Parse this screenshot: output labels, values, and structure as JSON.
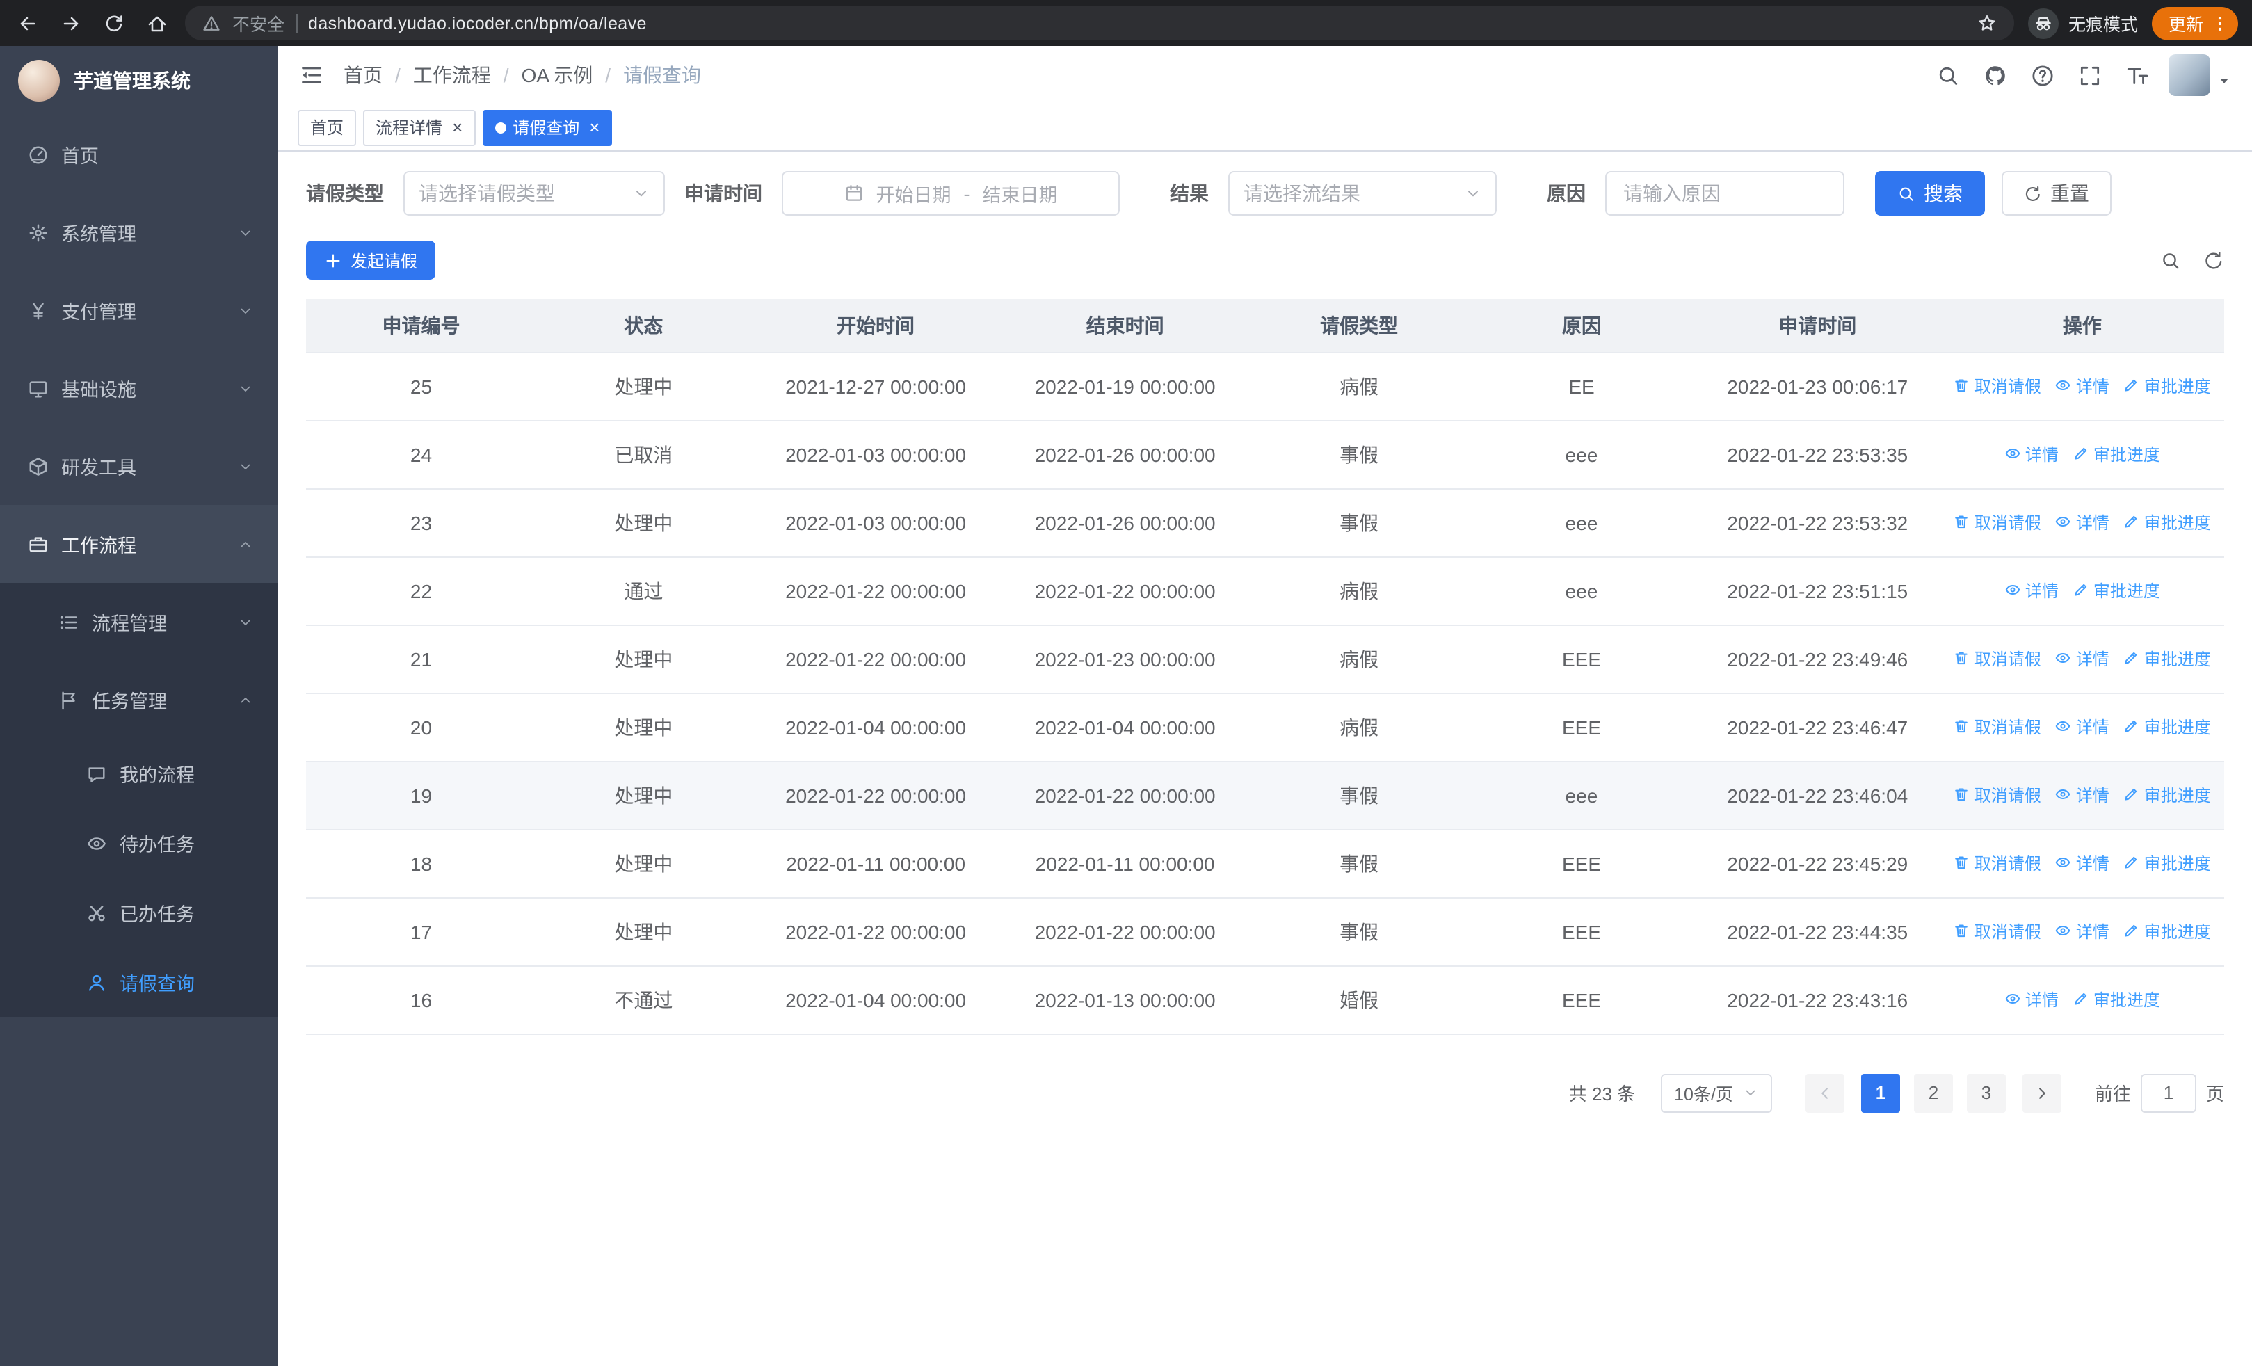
{
  "browser": {
    "nav_icons": [
      "back-icon",
      "forward-icon",
      "reload-icon",
      "home-icon"
    ],
    "security_label": "不安全",
    "url": "dashboard.yudao.iocoder.cn/bpm/oa/leave",
    "incognito_label": "无痕模式",
    "update_label": "更新"
  },
  "sidebar": {
    "title": "芋道管理系统",
    "menu": [
      {
        "label": "首页",
        "icon": "dashboard",
        "level": 1
      },
      {
        "label": "系统管理",
        "icon": "gear",
        "level": 1,
        "arrow": "down"
      },
      {
        "label": "支付管理",
        "icon": "yen",
        "level": 1,
        "arrow": "down"
      },
      {
        "label": "基础设施",
        "icon": "monitor",
        "level": 1,
        "arrow": "down"
      },
      {
        "label": "研发工具",
        "icon": "box",
        "level": 1,
        "arrow": "down"
      },
      {
        "label": "工作流程",
        "icon": "suitcase",
        "level": 1,
        "arrow": "up",
        "open": true
      },
      {
        "label": "流程管理",
        "icon": "list",
        "level": 2,
        "arrow": "down"
      },
      {
        "label": "任务管理",
        "icon": "flag",
        "level": 2,
        "arrow": "up",
        "open": true
      },
      {
        "label": "我的流程",
        "icon": "chat",
        "level": 3
      },
      {
        "label": "待办任务",
        "icon": "eye",
        "level": 3
      },
      {
        "label": "已办任务",
        "icon": "scissors",
        "level": 3
      },
      {
        "label": "请假查询",
        "icon": "user",
        "level": 3,
        "active": true
      }
    ]
  },
  "header": {
    "breadcrumb": [
      "首页",
      "工作流程",
      "OA 示例",
      "请假查询"
    ],
    "action_icons": [
      "search-icon",
      "github-icon",
      "question-icon",
      "fullscreen-icon",
      "font-size-icon"
    ]
  },
  "tabs": [
    {
      "label": "首页",
      "closable": false,
      "active": false
    },
    {
      "label": "流程详情",
      "closable": true,
      "active": false
    },
    {
      "label": "请假查询",
      "closable": true,
      "active": true
    }
  ],
  "filters": {
    "leave_type": {
      "label": "请假类型",
      "placeholder": "请选择请假类型"
    },
    "apply_time": {
      "label": "申请时间",
      "start_placeholder": "开始日期",
      "separator": "-",
      "end_placeholder": "结束日期"
    },
    "result": {
      "label": "结果",
      "placeholder": "请选择流结果"
    },
    "reason": {
      "label": "原因",
      "placeholder": "请输入原因"
    },
    "search_label": "搜索",
    "reset_label": "重置"
  },
  "toolbar": {
    "create_label": "发起请假",
    "right_icons": [
      "search-icon",
      "refresh-icon"
    ]
  },
  "table": {
    "columns": [
      "申请编号",
      "状态",
      "开始时间",
      "结束时间",
      "请假类型",
      "原因",
      "申请时间",
      "操作"
    ],
    "rows": [
      {
        "id": "25",
        "status": "处理中",
        "start": "2021-12-27 00:00:00",
        "end": "2022-01-19 00:00:00",
        "type": "病假",
        "reason": "EE",
        "applied": "2022-01-23 00:06:17",
        "highlighted": false,
        "actions": [
          {
            "icon": "trash-icon",
            "label": "取消请假"
          },
          {
            "icon": "eye-icon",
            "label": "详情"
          },
          {
            "icon": "edit-icon",
            "label": "审批进度"
          }
        ]
      },
      {
        "id": "24",
        "status": "已取消",
        "start": "2022-01-03 00:00:00",
        "end": "2022-01-26 00:00:00",
        "type": "事假",
        "reason": "eee",
        "applied": "2022-01-22 23:53:35",
        "highlighted": false,
        "actions": [
          {
            "icon": "eye-icon",
            "label": "详情"
          },
          {
            "icon": "edit-icon",
            "label": "审批进度"
          }
        ]
      },
      {
        "id": "23",
        "status": "处理中",
        "start": "2022-01-03 00:00:00",
        "end": "2022-01-26 00:00:00",
        "type": "事假",
        "reason": "eee",
        "applied": "2022-01-22 23:53:32",
        "highlighted": false,
        "actions": [
          {
            "icon": "trash-icon",
            "label": "取消请假"
          },
          {
            "icon": "eye-icon",
            "label": "详情"
          },
          {
            "icon": "edit-icon",
            "label": "审批进度"
          }
        ]
      },
      {
        "id": "22",
        "status": "通过",
        "start": "2022-01-22 00:00:00",
        "end": "2022-01-22 00:00:00",
        "type": "病假",
        "reason": "eee",
        "applied": "2022-01-22 23:51:15",
        "highlighted": false,
        "actions": [
          {
            "icon": "eye-icon",
            "label": "详情"
          },
          {
            "icon": "edit-icon",
            "label": "审批进度"
          }
        ]
      },
      {
        "id": "21",
        "status": "处理中",
        "start": "2022-01-22 00:00:00",
        "end": "2022-01-23 00:00:00",
        "type": "病假",
        "reason": "EEE",
        "applied": "2022-01-22 23:49:46",
        "highlighted": false,
        "actions": [
          {
            "icon": "trash-icon",
            "label": "取消请假"
          },
          {
            "icon": "eye-icon",
            "label": "详情"
          },
          {
            "icon": "edit-icon",
            "label": "审批进度"
          }
        ]
      },
      {
        "id": "20",
        "status": "处理中",
        "start": "2022-01-04 00:00:00",
        "end": "2022-01-04 00:00:00",
        "type": "病假",
        "reason": "EEE",
        "applied": "2022-01-22 23:46:47",
        "highlighted": false,
        "actions": [
          {
            "icon": "trash-icon",
            "label": "取消请假"
          },
          {
            "icon": "eye-icon",
            "label": "详情"
          },
          {
            "icon": "edit-icon",
            "label": "审批进度"
          }
        ]
      },
      {
        "id": "19",
        "status": "处理中",
        "start": "2022-01-22 00:00:00",
        "end": "2022-01-22 00:00:00",
        "type": "事假",
        "reason": "eee",
        "applied": "2022-01-22 23:46:04",
        "highlighted": true,
        "actions": [
          {
            "icon": "trash-icon",
            "label": "取消请假"
          },
          {
            "icon": "eye-icon",
            "label": "详情"
          },
          {
            "icon": "edit-icon",
            "label": "审批进度"
          }
        ]
      },
      {
        "id": "18",
        "status": "处理中",
        "start": "2022-01-11 00:00:00",
        "end": "2022-01-11 00:00:00",
        "type": "事假",
        "reason": "EEE",
        "applied": "2022-01-22 23:45:29",
        "highlighted": false,
        "actions": [
          {
            "icon": "trash-icon",
            "label": "取消请假"
          },
          {
            "icon": "eye-icon",
            "label": "详情"
          },
          {
            "icon": "edit-icon",
            "label": "审批进度"
          }
        ]
      },
      {
        "id": "17",
        "status": "处理中",
        "start": "2022-01-22 00:00:00",
        "end": "2022-01-22 00:00:00",
        "type": "事假",
        "reason": "EEE",
        "applied": "2022-01-22 23:44:35",
        "highlighted": false,
        "actions": [
          {
            "icon": "trash-icon",
            "label": "取消请假"
          },
          {
            "icon": "eye-icon",
            "label": "详情"
          },
          {
            "icon": "edit-icon",
            "label": "审批进度"
          }
        ]
      },
      {
        "id": "16",
        "status": "不通过",
        "start": "2022-01-04 00:00:00",
        "end": "2022-01-13 00:00:00",
        "type": "婚假",
        "reason": "EEE",
        "applied": "2022-01-22 23:43:16",
        "highlighted": false,
        "actions": [
          {
            "icon": "eye-icon",
            "label": "详情"
          },
          {
            "icon": "edit-icon",
            "label": "审批进度"
          }
        ]
      }
    ]
  },
  "pagination": {
    "total": "共 23 条",
    "page_size": "10条/页",
    "pages": [
      "1",
      "2",
      "3"
    ],
    "active_page": "1",
    "goto_label": "前往",
    "goto_value": "1",
    "goto_unit": "页"
  }
}
